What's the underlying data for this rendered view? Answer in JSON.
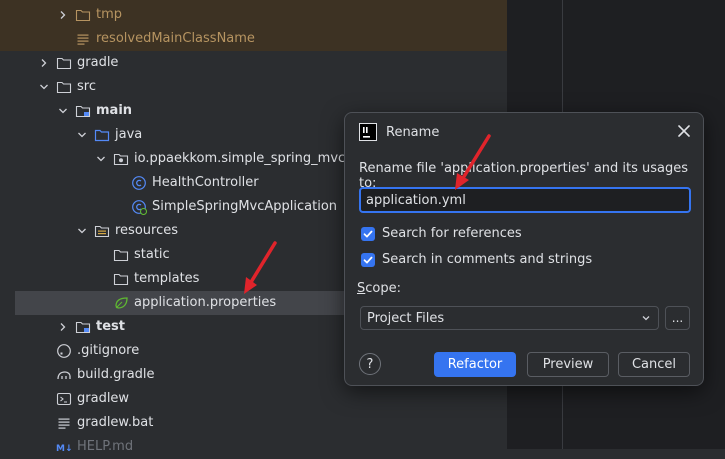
{
  "project_tree": {
    "items": [
      {
        "label": "tmp",
        "icon": "folder-icon",
        "state": "collapsed",
        "style": "excluded"
      },
      {
        "label": "resolvedMainClassName",
        "icon": "text-file-icon",
        "state": "leaf",
        "style": "excluded"
      },
      {
        "label": "gradle",
        "icon": "folder-icon",
        "state": "collapsed",
        "style": "normal"
      },
      {
        "label": "src",
        "icon": "folder-icon",
        "state": "expanded",
        "style": "normal"
      },
      {
        "label": "main",
        "icon": "module-folder-icon",
        "state": "expanded",
        "style": "bold"
      },
      {
        "label": "java",
        "icon": "source-folder-icon",
        "state": "expanded",
        "style": "normal"
      },
      {
        "label": "io.ppaekkom.simple_spring_mvc",
        "icon": "package-icon",
        "state": "expanded",
        "style": "normal"
      },
      {
        "label": "HealthController",
        "icon": "class-icon",
        "state": "leaf",
        "style": "normal"
      },
      {
        "label": "SimpleSpringMvcApplication",
        "icon": "spring-class-icon",
        "state": "leaf",
        "style": "normal"
      },
      {
        "label": "resources",
        "icon": "resources-folder-icon",
        "state": "expanded",
        "style": "normal"
      },
      {
        "label": "static",
        "icon": "folder-icon",
        "state": "leaf",
        "style": "normal"
      },
      {
        "label": "templates",
        "icon": "folder-icon",
        "state": "leaf",
        "style": "normal"
      },
      {
        "label": "application.properties",
        "icon": "spring-properties-icon",
        "state": "leaf",
        "style": "selected"
      },
      {
        "label": "test",
        "icon": "module-folder-icon",
        "state": "collapsed",
        "style": "bold"
      },
      {
        "label": ".gitignore",
        "icon": "ignore-file-icon",
        "state": "leaf",
        "style": "normal"
      },
      {
        "label": "build.gradle",
        "icon": "gradle-file-icon",
        "state": "leaf",
        "style": "normal"
      },
      {
        "label": "gradlew",
        "icon": "shell-file-icon",
        "state": "leaf",
        "style": "normal"
      },
      {
        "label": "gradlew.bat",
        "icon": "text-file-icon",
        "state": "leaf",
        "style": "normal"
      },
      {
        "label": "HELP.md",
        "icon": "markdown-icon",
        "state": "leaf",
        "style": "dim"
      }
    ]
  },
  "dialog": {
    "title": "Rename",
    "app_icon": "intellij-icon",
    "prompt": "Rename file 'application.properties' and its usages to:",
    "new_name": "application.yml",
    "options": [
      {
        "label": "Search for references",
        "checked": true
      },
      {
        "label": "Search in comments and strings",
        "checked": true
      }
    ],
    "scope_label": "Scope:",
    "scope_value": "Project Files",
    "more_button": "...",
    "help_button": "?",
    "buttons": {
      "refactor": "Refactor",
      "preview": "Preview",
      "cancel": "Cancel"
    }
  },
  "colors": {
    "accent": "#3574f0",
    "annotation_arrow": "#e0242b",
    "excluded_text": "#b69461",
    "background": "#2b2d30"
  }
}
